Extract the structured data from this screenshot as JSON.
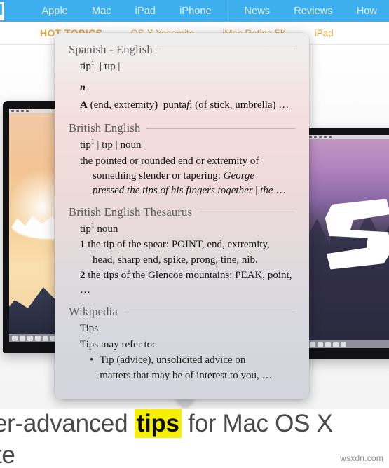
{
  "site": {
    "logo_text": "d",
    "nav_left": [
      "Apple",
      "Mac",
      "iPad",
      "iPhone"
    ],
    "nav_right": [
      "News",
      "Reviews",
      "How"
    ],
    "hot_topics_label": "HOT TOPICS",
    "hot_topics": [
      "OS X Yosemite",
      "iMac Retina 5K",
      "iPad"
    ]
  },
  "dictionary": {
    "sections": [
      {
        "title": "Spanish - English",
        "headword": "tip",
        "superscript": "1",
        "pronunciation": "| tɪp |",
        "pos_italic": "n",
        "definition_parts": {
          "sense_letter": "A",
          "context1": "(end, extremity)",
          "translation": "punta",
          "gender": "f",
          "sep": ";",
          "context2": "(of stick, umbrella)",
          "ellipsis": "…"
        }
      },
      {
        "title": "British English",
        "headword": "tip",
        "superscript": "1",
        "pronunciation": "| tɪp |",
        "pos": "noun",
        "def_line1": "the pointed or rounded end or extremity of",
        "def_line2_plain": "something slender or tapering:",
        "def_line2_italic": "George",
        "def_line3_italic": "pressed the tips of his fingers together",
        "def_line3_pipe": "|",
        "def_line3_tail_italic": "the",
        "def_line3_ellipsis": "…"
      },
      {
        "title": "British English Thesaurus",
        "headword": "tip",
        "superscript": "1",
        "pos": "noun",
        "senses": [
          {
            "num": "1",
            "example": "the tip of the spear",
            "colon": ":",
            "synonyms_line1": "POINT, end, extremity,",
            "synonyms_line2": "head, sharp end, spike, prong, tine, nib."
          },
          {
            "num": "2",
            "example": "the tips of the Glencoe mountains",
            "colon": ":",
            "synonyms_line1": "PEAK, point, …"
          }
        ]
      },
      {
        "title": "Wikipedia",
        "wiki_title": "Tips",
        "wiki_lead": "Tips may refer to:",
        "bullet_mark": "•",
        "bullet_line1": "Tip (advice), unsolicited advice on",
        "bullet_line2": "matters that may be of interest to you,",
        "bullet_ellipsis": "…"
      }
    ]
  },
  "article": {
    "line1_pre": "er-advanced ",
    "line1_highlight": "tips",
    "line1_post": " for Mac OS X",
    "line2": "te",
    "highlight_color": "#f6f000"
  },
  "watermark": "wsxdn.com",
  "colors": {
    "nav_background": "#3daeee",
    "hot_topic_text": "#e8a33d",
    "popup_top": "#eeeeef",
    "popup_mid": "#f2dcdc",
    "popup_bottom": "#d2d5dc"
  }
}
